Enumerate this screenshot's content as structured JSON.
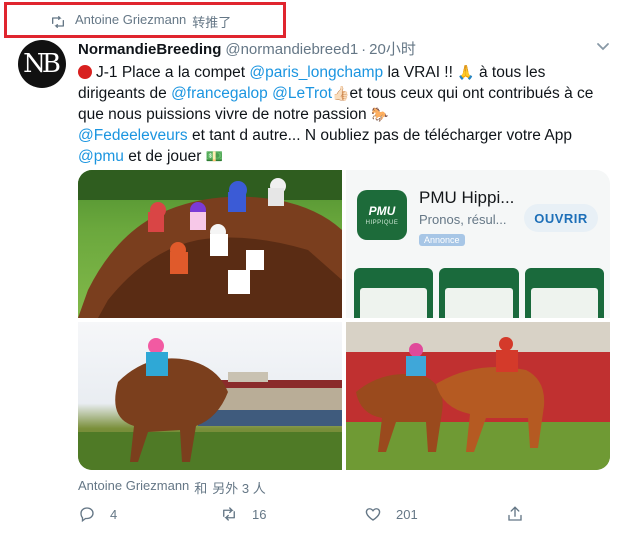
{
  "retweet": {
    "user": "Antoine Griezmann",
    "label": "转推了"
  },
  "tweet": {
    "avatar_text": "NB",
    "name": "NormandieBreeding",
    "handle": "@normandiebreed1",
    "separator": "·",
    "time": "20小时",
    "text": {
      "t1": "J-1 Place  a la compet ",
      "m1": "@paris_longchamp",
      "t2": " la VRAI !! ",
      "t3": " à tous les dirigeants de ",
      "m2": "@francegalop",
      "t4": " ",
      "m3": "@LeTrot",
      "t5": "et tous ceux qui ont contribués à ce que nous puissions vivre de notre passion ",
      "m4": "@Fedeeleveurs",
      "t6": " et tant d autre... N oubliez pas de télécharger votre App ",
      "m5": "@pmu",
      "t7": " et de jouer "
    },
    "emojis": {
      "pray": "🙏",
      "thumbs": "👍🏻",
      "horse": "🐎",
      "money": "💵"
    }
  },
  "app_card": {
    "title": "PMU Hippi...",
    "subtitle": "Pronos, résul...",
    "badge": "Annonce",
    "button": "OUVRIR",
    "logo": "PMU",
    "logo_sub": "HIPPIQUE"
  },
  "context": {
    "users": "Antoine Griezmann",
    "and": "和",
    "others": "另外 3 人"
  },
  "actions": {
    "replies": "4",
    "retweets": "16",
    "likes": "201"
  },
  "colors": {
    "accent": "#1b95e0",
    "highlight": "#e0252e",
    "muted": "#657786"
  },
  "icons": [
    "retweet-icon",
    "caret-down-icon",
    "reply-icon",
    "like-icon",
    "share-icon"
  ]
}
